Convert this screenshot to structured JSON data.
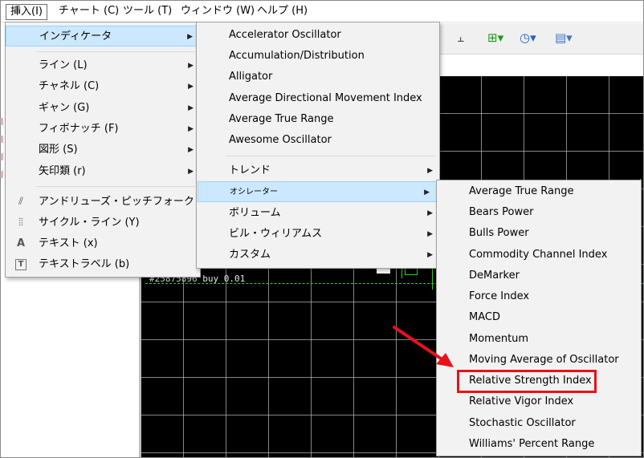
{
  "menubar": {
    "items": [
      {
        "label": "挿入(I)"
      },
      {
        "label": "チャート (C)"
      },
      {
        "label": "ツール (T)"
      },
      {
        "label": "ウィンドウ (W)"
      },
      {
        "label": "ヘルプ (H)"
      }
    ]
  },
  "chart": {
    "trade_label": "#25875896 buy 0.01"
  },
  "insert_menu": {
    "indicators": "インディケータ",
    "lines": "ライン (L)",
    "channels": "チャネル (C)",
    "gann": "ギャン (G)",
    "fibonacci": "フィボナッチ (F)",
    "shapes": "図形 (S)",
    "arrows": "矢印類 (r)",
    "andrews_pitchfork": "アンドリューズ・ピッチフォーク (A)",
    "cycle_lines": "サイクル・ライン (Y)",
    "text": "テキスト (x)",
    "text_label": "テキストラベル (b)"
  },
  "indicators_menu": {
    "items": [
      "Accelerator Oscillator",
      "Accumulation/Distribution",
      "Alligator",
      "Average Directional Movement Index",
      "Average True Range",
      "Awesome Oscillator"
    ],
    "trend": "トレンド",
    "oscillators": "オシレーター",
    "volumes": "ボリューム",
    "bill_williams": "ビル・ウィリアムス",
    "custom": "カスタム"
  },
  "oscillators_menu": {
    "items": [
      "Average True Range",
      "Bears Power",
      "Bulls Power",
      "Commodity Channel Index",
      "DeMarker",
      "Force Index",
      "MACD",
      "Momentum",
      "Moving Average of Oscillator",
      "Relative Strength Index",
      "Relative Vigor Index",
      "Stochastic Oscillator",
      "Williams' Percent Range"
    ],
    "highlighted": "Relative Strength Index"
  },
  "colors": {
    "highlight_bg": "#cce8ff",
    "annotation_red": "#e8111a",
    "chart_bg": "#000000",
    "grid_green": "#2ed12e"
  }
}
